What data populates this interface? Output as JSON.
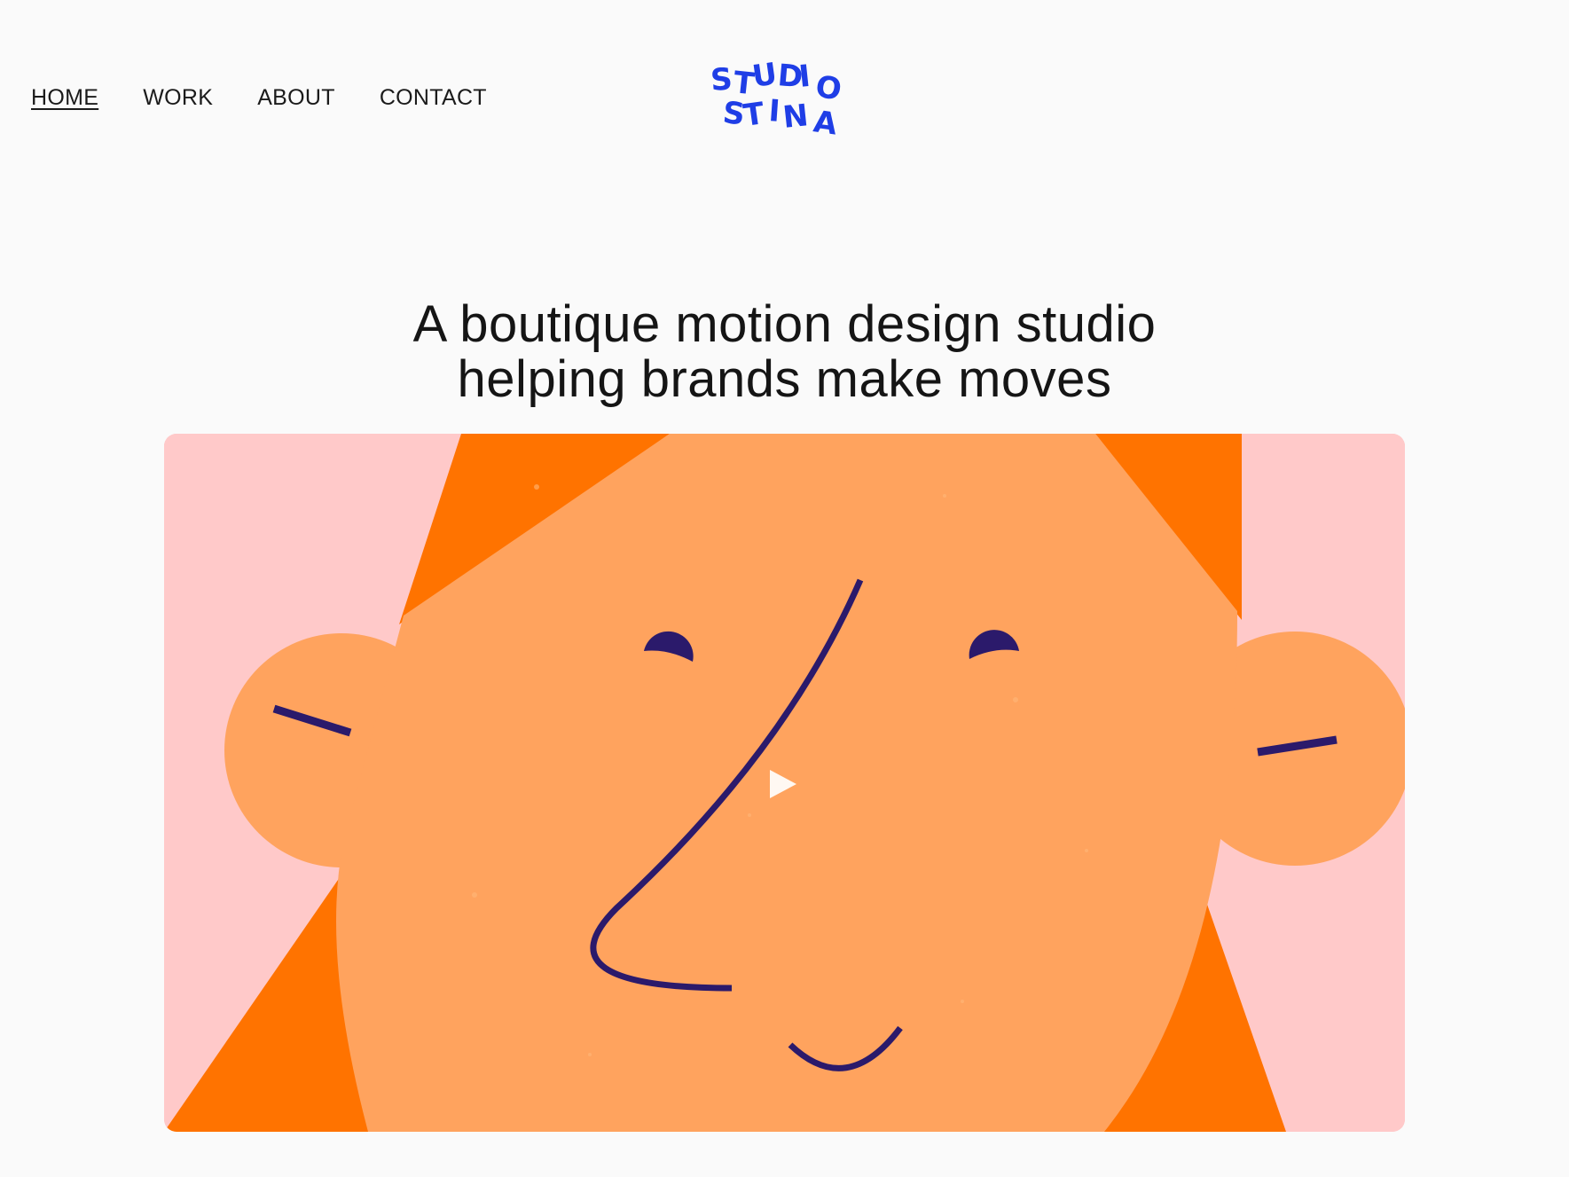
{
  "nav": {
    "items": [
      {
        "label": "HOME",
        "active": true
      },
      {
        "label": "WORK",
        "active": false
      },
      {
        "label": "ABOUT",
        "active": false
      },
      {
        "label": "CONTACT",
        "active": false
      }
    ]
  },
  "logo": {
    "line1": "STUDIO",
    "line2": "STINA",
    "color": "#1f3ee6"
  },
  "hero": {
    "headline_line1": "A boutique motion design studio",
    "headline_line2": "helping brands make moves"
  },
  "video": {
    "play_icon": "play-icon",
    "colors": {
      "background": "#ffc9c9",
      "hair": "#ff7300",
      "face": "#ffa35e",
      "features": "#2b1a6b"
    }
  }
}
